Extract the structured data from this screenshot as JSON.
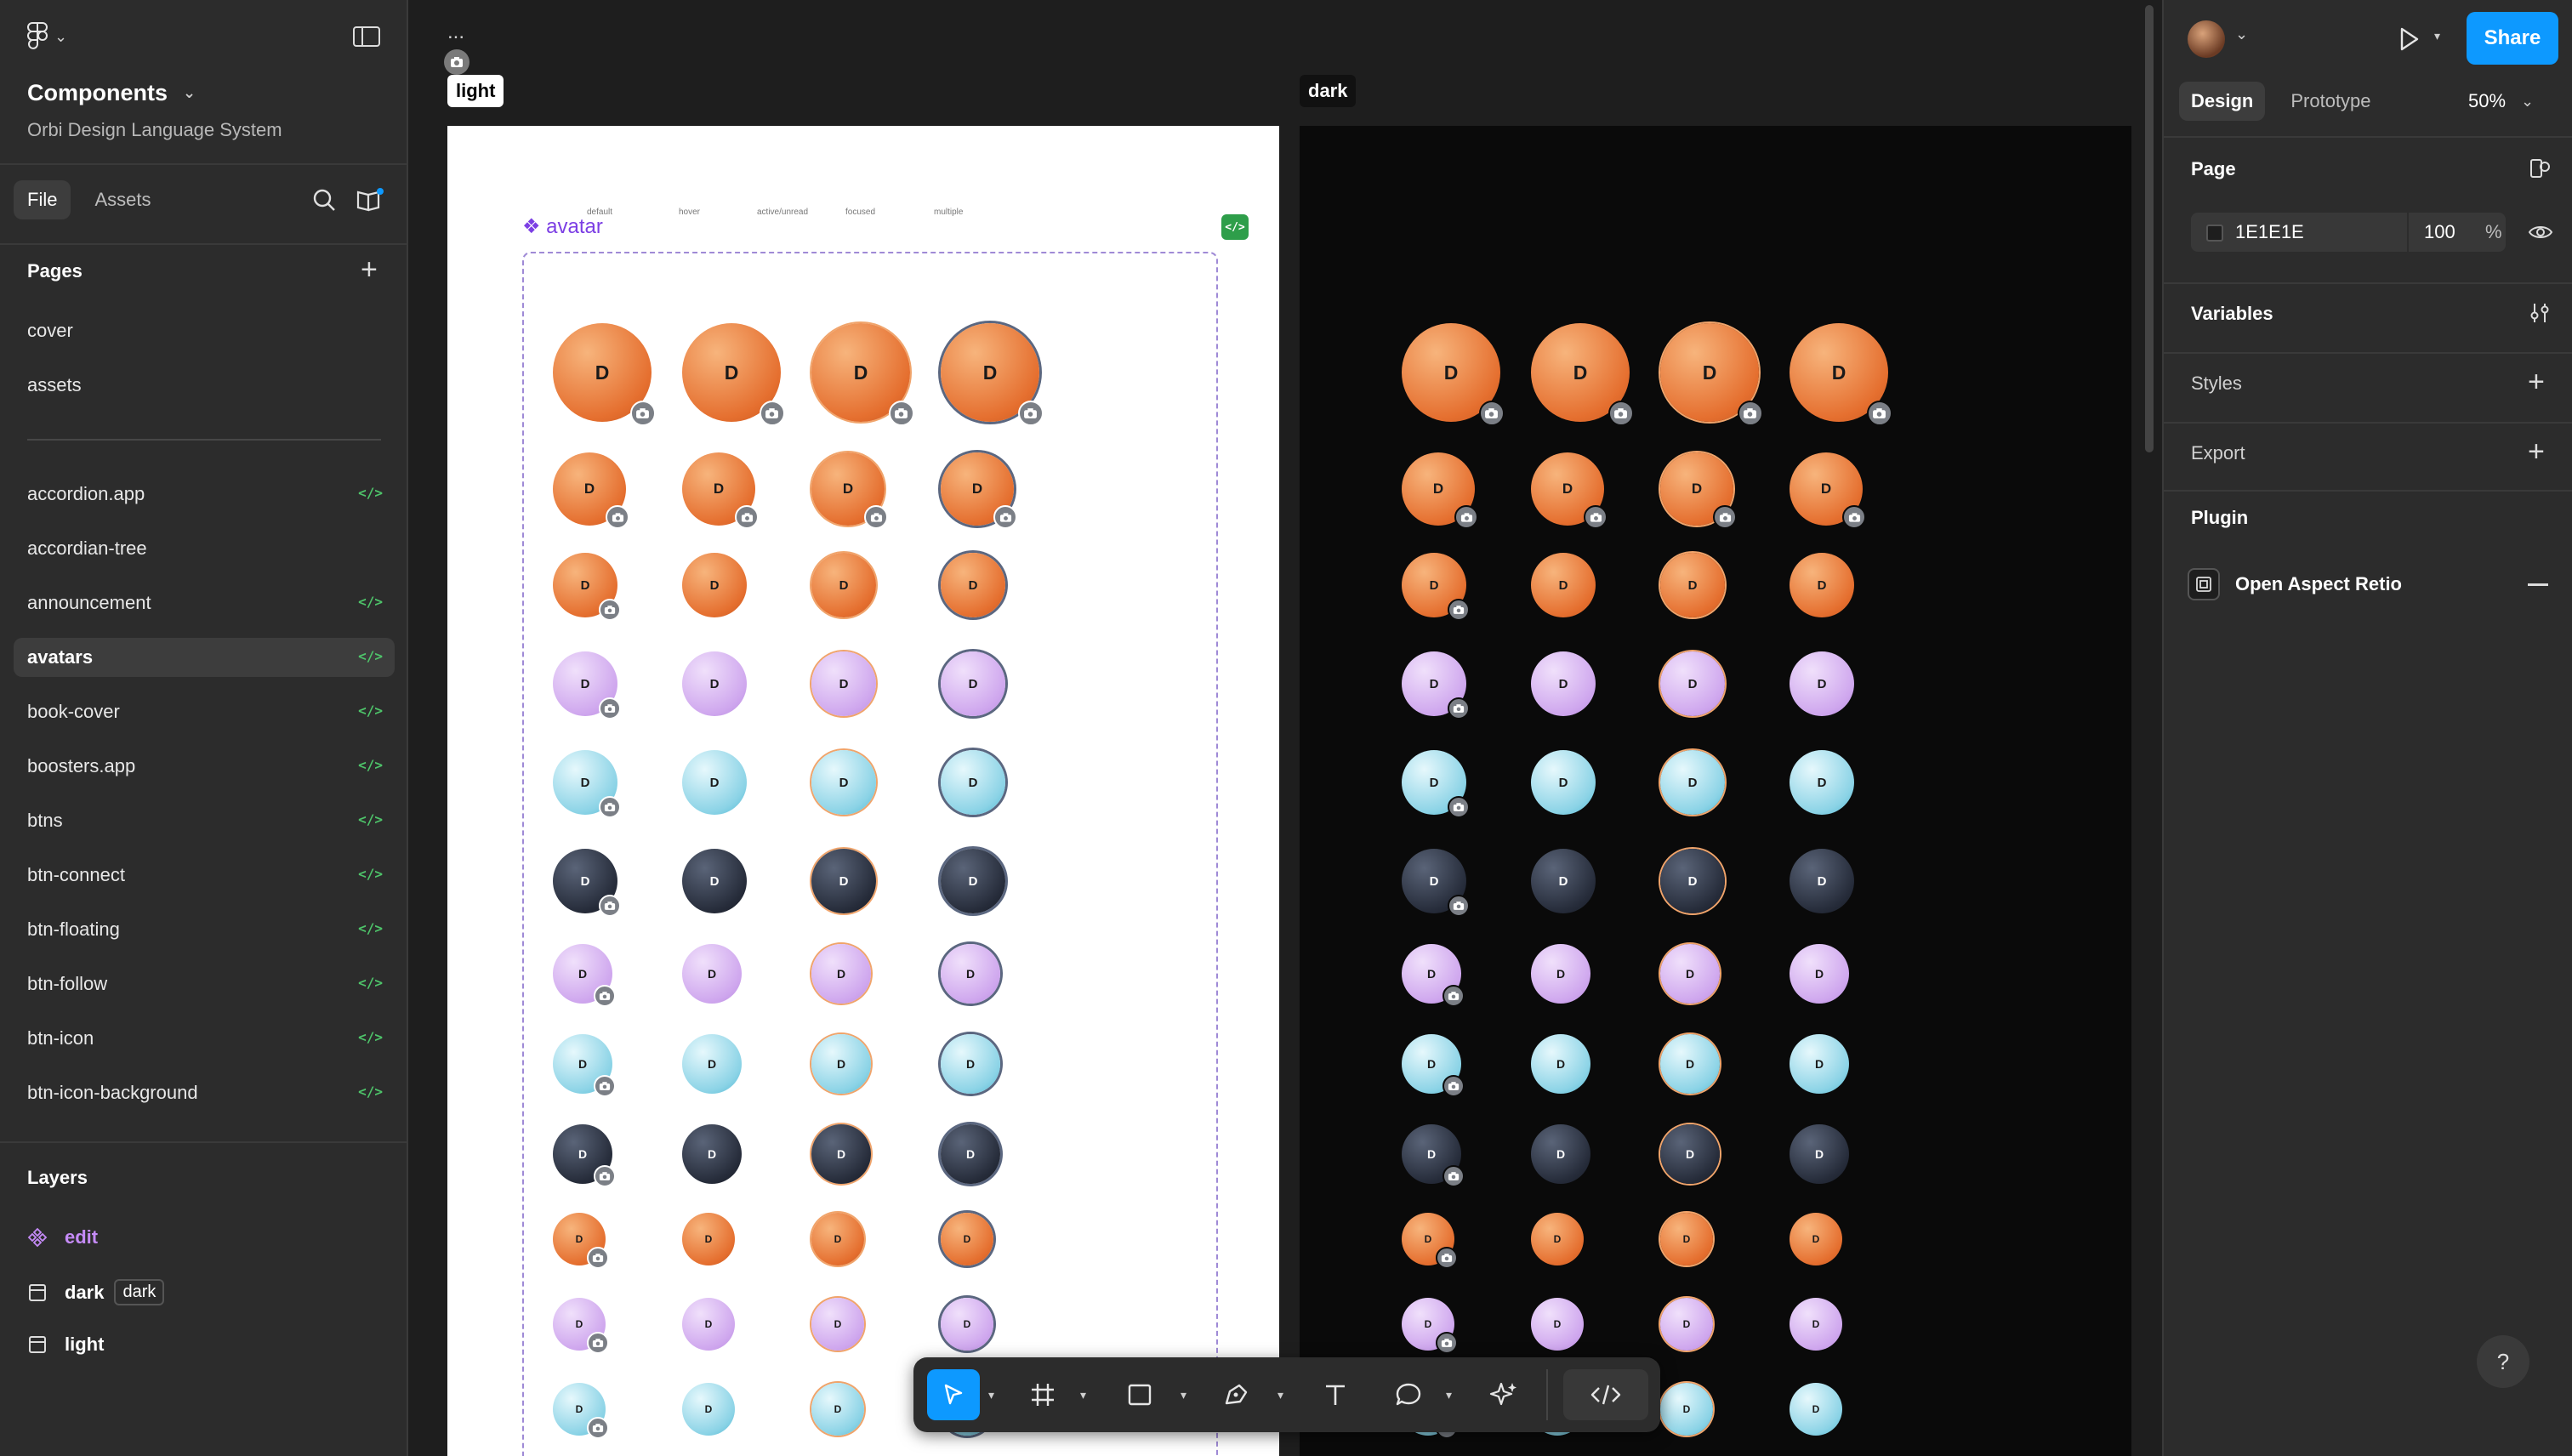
{
  "app": {
    "file_title": "Components",
    "file_subtitle": "Orbi Design Language System",
    "tabs": [
      "File",
      "Assets"
    ]
  },
  "pages": {
    "heading": "Pages",
    "items": [
      {
        "label": "cover",
        "has_code": false
      },
      {
        "label": "assets",
        "has_code": false
      },
      {
        "label": "accordion.app",
        "has_code": true
      },
      {
        "label": "accordian-tree",
        "has_code": false
      },
      {
        "label": "announcement",
        "has_code": true
      },
      {
        "label": "avatars",
        "has_code": true,
        "active": true
      },
      {
        "label": "book-cover",
        "has_code": true
      },
      {
        "label": "boosters.app",
        "has_code": true
      },
      {
        "label": "btns",
        "has_code": true
      },
      {
        "label": "btn-connect",
        "has_code": true
      },
      {
        "label": "btn-floating",
        "has_code": true
      },
      {
        "label": "btn-follow",
        "has_code": true
      },
      {
        "label": "btn-icon",
        "has_code": true
      },
      {
        "label": "btn-icon-background",
        "has_code": true
      }
    ],
    "code_glyph": "</>"
  },
  "layers": {
    "heading": "Layers",
    "items": [
      {
        "label": "edit",
        "icon": "component-icon"
      },
      {
        "label": "dark",
        "icon": "frame-icon",
        "tag": "dark"
      },
      {
        "label": "light",
        "icon": "frame-icon"
      }
    ]
  },
  "canvas": {
    "ellipsis": "...",
    "frames": [
      {
        "label": "light"
      },
      {
        "label": "dark"
      }
    ],
    "component_title": "❖ avatar",
    "column_headers": [
      "default",
      "hover",
      "active/unread",
      "focused",
      "multiple"
    ],
    "code_chip": "</>",
    "avatar_initial": "D",
    "rows": [
      {
        "color": "orange",
        "camera": [
          true,
          true,
          true,
          true
        ]
      },
      {
        "color": "orange",
        "camera": [
          true,
          true,
          true,
          true
        ]
      },
      {
        "color": "orange",
        "camera": [
          true,
          false,
          false,
          false
        ]
      },
      {
        "color": "purple",
        "camera": [
          true,
          false,
          false,
          false
        ]
      },
      {
        "color": "teal",
        "camera": [
          true,
          false,
          false,
          false
        ]
      },
      {
        "color": "navy",
        "camera": [
          true,
          false,
          false,
          false
        ]
      },
      {
        "color": "purple",
        "camera": [
          true,
          false,
          false,
          false
        ]
      },
      {
        "color": "teal",
        "camera": [
          true,
          false,
          false,
          false
        ]
      },
      {
        "color": "navy",
        "camera": [
          true,
          false,
          false,
          false
        ]
      },
      {
        "color": "orange",
        "camera": [
          true,
          false,
          false,
          false
        ]
      },
      {
        "color": "purple",
        "camera": [
          true,
          false,
          false,
          false
        ]
      },
      {
        "color": "teal",
        "camera": [
          true,
          false,
          false,
          false
        ]
      }
    ]
  },
  "toolbar": {
    "tools": [
      "move-tool",
      "frame-tool",
      "shape-tool",
      "pen-tool",
      "text-tool",
      "comment-tool",
      "actions-tool",
      "dev-mode-toggle"
    ]
  },
  "right_panel": {
    "share_label": "Share",
    "tabs": [
      "Design",
      "Prototype"
    ],
    "zoom": "50%",
    "page_heading": "Page",
    "page_fill_hex": "1E1E1E",
    "page_fill_opacity": "100",
    "percent_sign": "%",
    "variables_heading": "Variables",
    "styles_heading": "Styles",
    "export_heading": "Export",
    "plugin_heading": "Plugin",
    "plugin_name": "Open Aspect Retio",
    "help": "?"
  },
  "colors": {
    "accent": "#0d99ff",
    "code_green": "#4ec46a",
    "component_purple": "#c58bf7"
  }
}
